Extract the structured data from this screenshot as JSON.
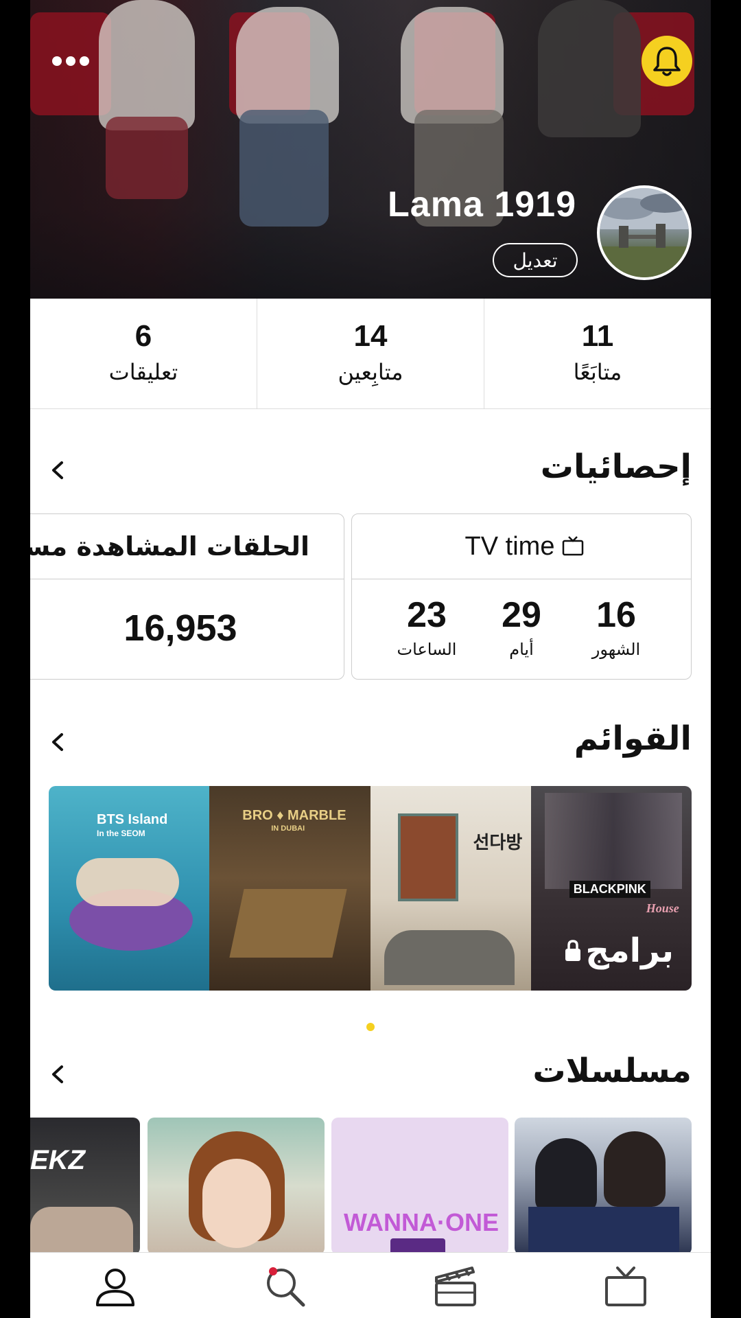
{
  "profile": {
    "username": "Lama 1919",
    "edit_label": "تعديل"
  },
  "stats": [
    {
      "value": "11",
      "label": "متابَعًا"
    },
    {
      "value": "14",
      "label": "متابِعين"
    },
    {
      "value": "6",
      "label": "تعليقات"
    }
  ],
  "statistics": {
    "title": "إحصائيات",
    "tv_time": {
      "title": "TV time",
      "months": {
        "value": "16",
        "label": "الشهور"
      },
      "days": {
        "value": "29",
        "label": "أيام"
      },
      "hours": {
        "value": "23",
        "label": "الساعات"
      }
    },
    "episodes": {
      "title": "الحلقات المشاهدة مسبقًا",
      "value": "16,953"
    }
  },
  "lists": {
    "title": "القوائم",
    "banner_label": "برامج",
    "posters": [
      {
        "text_line1": "BTS Island",
        "text_line2": "In the SEOM"
      },
      {
        "text_line1": "BRO ♦ MARBLE",
        "text_line2": "IN DUBAI"
      },
      {
        "text_line1": "선다방",
        "text_line2": ""
      },
      {
        "text_line1": "BLACKPINK",
        "text_line2": "House"
      }
    ]
  },
  "series": {
    "title": "مسلسلات",
    "thumbs": [
      {
        "text": "WANNA·ONE"
      },
      {
        "text": "EKZ"
      }
    ]
  },
  "nav": {
    "items": [
      "tv-icon",
      "clapperboard-icon",
      "search-icon",
      "profile-icon"
    ]
  },
  "colors": {
    "accent": "#f5d020",
    "text": "#111111",
    "border": "#cccccc"
  }
}
